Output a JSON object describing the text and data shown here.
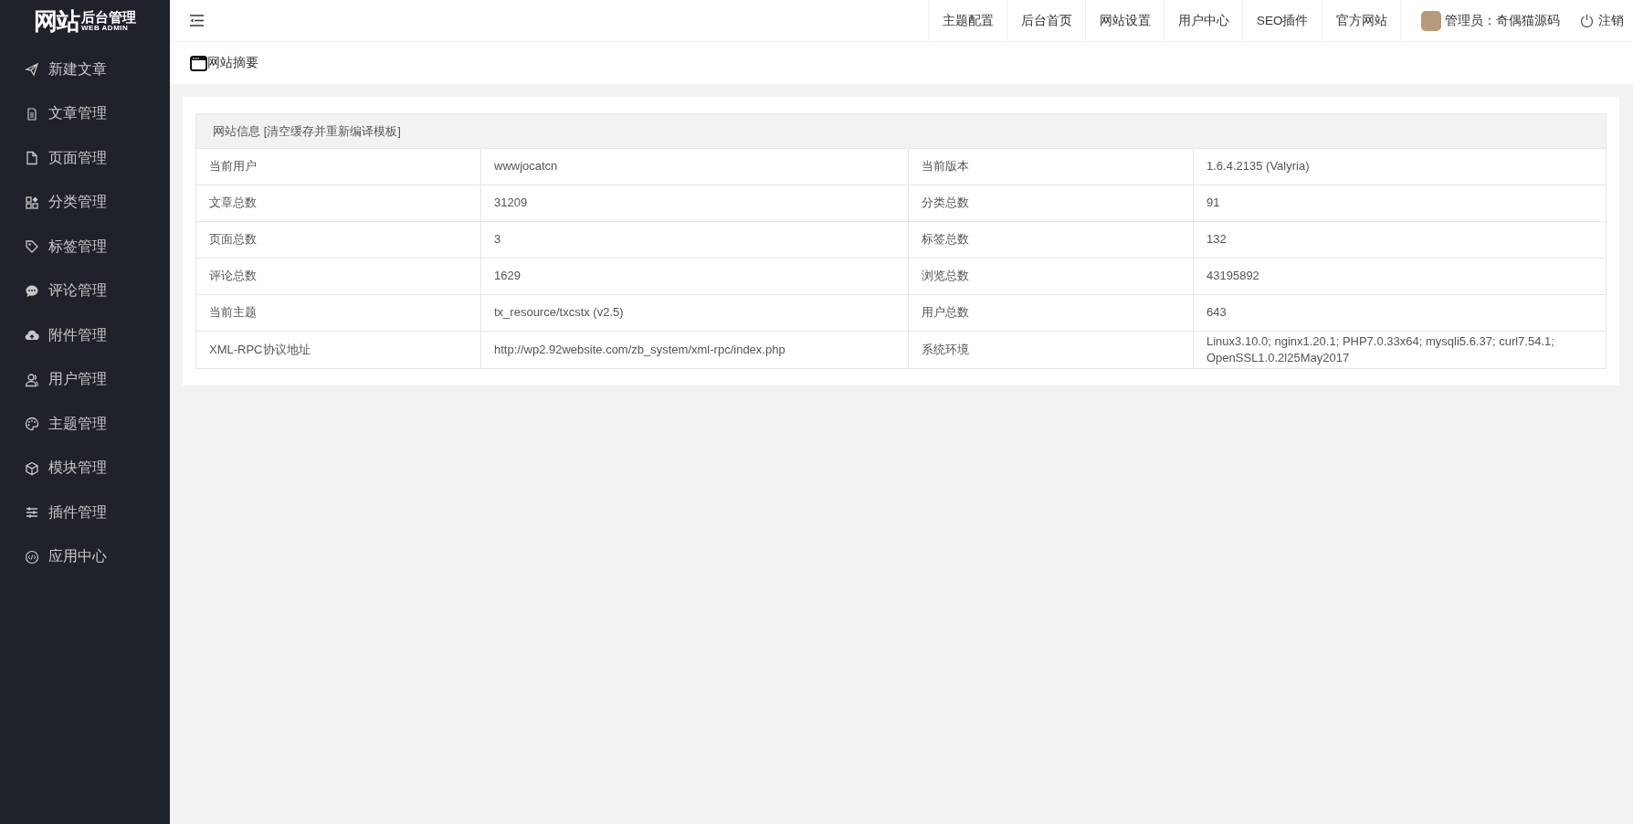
{
  "logo": {
    "title": "网站",
    "subtitle": "后台管理",
    "tagline": "WEB ADMIN"
  },
  "sidebar": {
    "items": [
      {
        "label": "新建文章"
      },
      {
        "label": "文章管理"
      },
      {
        "label": "页面管理"
      },
      {
        "label": "分类管理"
      },
      {
        "label": "标签管理"
      },
      {
        "label": "评论管理"
      },
      {
        "label": "附件管理"
      },
      {
        "label": "用户管理"
      },
      {
        "label": "主题管理"
      },
      {
        "label": "模块管理"
      },
      {
        "label": "插件管理"
      },
      {
        "label": "应用中心"
      }
    ]
  },
  "topbar": {
    "links": [
      "主题配置",
      "后台首页",
      "网站设置",
      "用户中心",
      "SEO插件",
      "官方网站"
    ],
    "user": "管理员：奇偶猫源码",
    "logout": "注销"
  },
  "breadcrumb": "网站摘要",
  "panel": {
    "title": "网站信息",
    "action": "[清空缓存并重新编译模板]",
    "rows": [
      {
        "cells": [
          "当前用户",
          "wwwjocatcn",
          "当前版本",
          "1.6.4.2135 (Valyria)"
        ]
      },
      {
        "cells": [
          "文章总数",
          "31209",
          "分类总数",
          "91"
        ]
      },
      {
        "cells": [
          "页面总数",
          "3",
          "标签总数",
          "132"
        ]
      },
      {
        "cells": [
          "评论总数",
          "1629",
          "浏览总数",
          "43195892"
        ]
      },
      {
        "cells": [
          "当前主题",
          "tx_resource/txcstx (v2.5)",
          "用户总数",
          "643"
        ]
      },
      {
        "cells": [
          "XML-RPC协议地址",
          "http://wp2.92website.com/zb_system/xml-rpc/index.php",
          "系统环境",
          "Linux3.10.0; nginx1.20.1; PHP7.0.33x64; mysqli5.6.37; curl7.54.1; OpenSSL1.0.2l25May2017"
        ]
      }
    ]
  }
}
